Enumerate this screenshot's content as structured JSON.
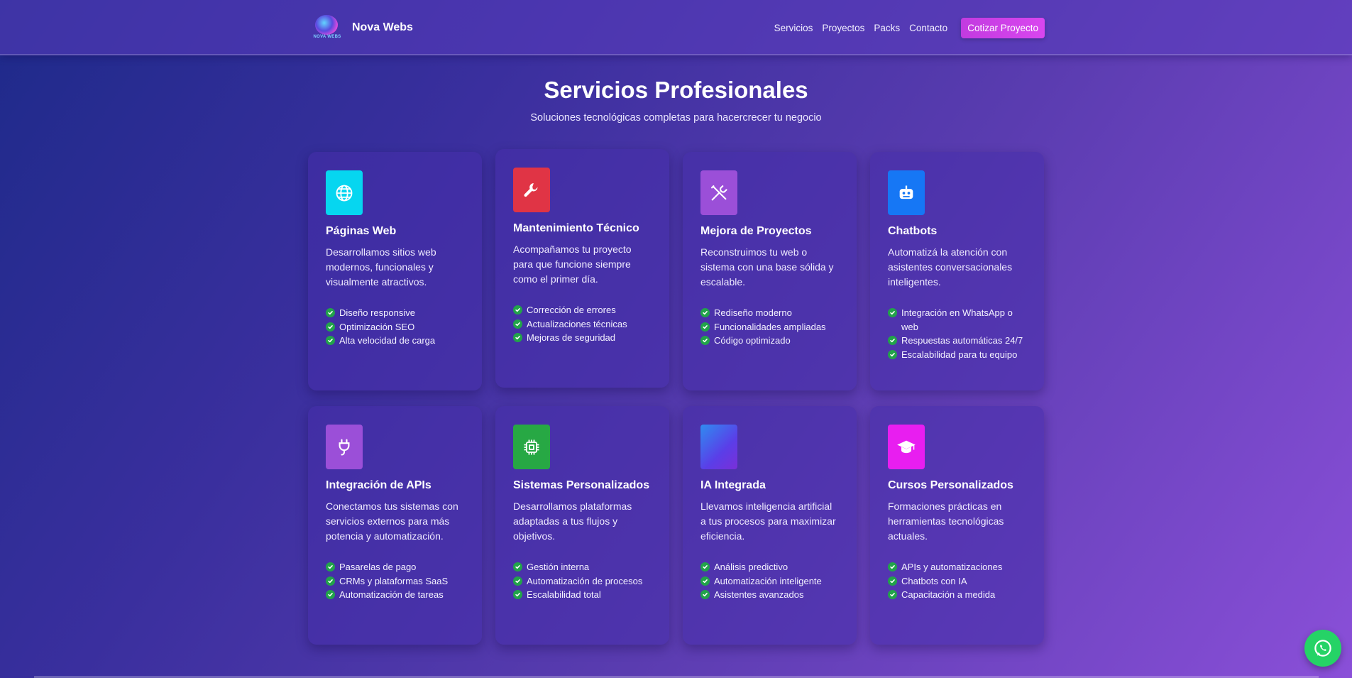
{
  "brand": {
    "name": "Nova Webs",
    "logo_text": "NOVA WEBS"
  },
  "nav": {
    "links": [
      "Servicios",
      "Proyectos",
      "Packs",
      "Contacto"
    ],
    "cta": "Cotizar Proyecto"
  },
  "section": {
    "title": "Servicios Profesionales",
    "subtitle": "Soluciones tecnológicas completas para hacercrecer tu negocio"
  },
  "cards": [
    {
      "title": "Páginas Web",
      "desc": "Desarrollamos sitios web modernos, funcionales y visualmente atractivos.",
      "icon": "globe-icon",
      "color": "#06d6f0",
      "features": [
        "Diseño responsive",
        "Optimización SEO",
        "Alta velocidad de carga"
      ]
    },
    {
      "title": "Mantenimiento Técnico",
      "desc": "Acompañamos tu proyecto para que funcione siempre como el primer día.",
      "icon": "wrench-icon",
      "color": "#e03445",
      "features": [
        "Corrección de errores",
        "Actualizaciones técnicas",
        "Mejoras de seguridad"
      ]
    },
    {
      "title": "Mejora de Proyectos",
      "desc": "Reconstruimos tu web o sistema con una base sólida y escalable.",
      "icon": "tools-icon",
      "color": "#9b4fd8",
      "features": [
        "Rediseño moderno",
        "Funcionalidades ampliadas",
        "Código optimizado"
      ]
    },
    {
      "title": "Chatbots",
      "desc": "Automatizá la atención con asistentes conversacionales inteligentes.",
      "icon": "robot-icon",
      "color": "#1677f5",
      "features": [
        "Integración en WhatsApp o web",
        "Respuestas automáticas 24/7",
        "Escalabilidad para tu equipo"
      ]
    },
    {
      "title": "Integración de APIs",
      "desc": "Conectamos tus sistemas con servicios externos para más potencia y automatización.",
      "icon": "plug-icon",
      "color": "#9b4fd8",
      "features": [
        "Pasarelas de pago",
        "CRMs y plataformas SaaS",
        "Automatización de tareas"
      ]
    },
    {
      "title": "Sistemas Personalizados",
      "desc": "Desarrollamos plataformas adaptadas a tus flujos y objetivos.",
      "icon": "cpu-icon",
      "color": "#27a844",
      "features": [
        "Gestión interna",
        "Automatización de procesos",
        "Escalabilidad total"
      ]
    },
    {
      "title": "IA Integrada",
      "desc": "Llevamos inteligencia artificial a tus procesos para maximizar eficiencia.",
      "icon": "gradient-square-icon",
      "color": "#4a5cf0",
      "features": [
        "Análisis predictivo",
        "Automatización inteligente",
        "Asistentes avanzados"
      ]
    },
    {
      "title": "Cursos Personalizados",
      "desc": "Formaciones prácticas en herramientas tecnológicas actuales.",
      "icon": "graduation-cap-icon",
      "color": "#e81ef0",
      "features": [
        "APIs y automatizaciones",
        "Chatbots con IA",
        "Capacitación a medida"
      ]
    }
  ],
  "whatsapp": {
    "icon": "whatsapp-icon",
    "color": "#25d366"
  }
}
